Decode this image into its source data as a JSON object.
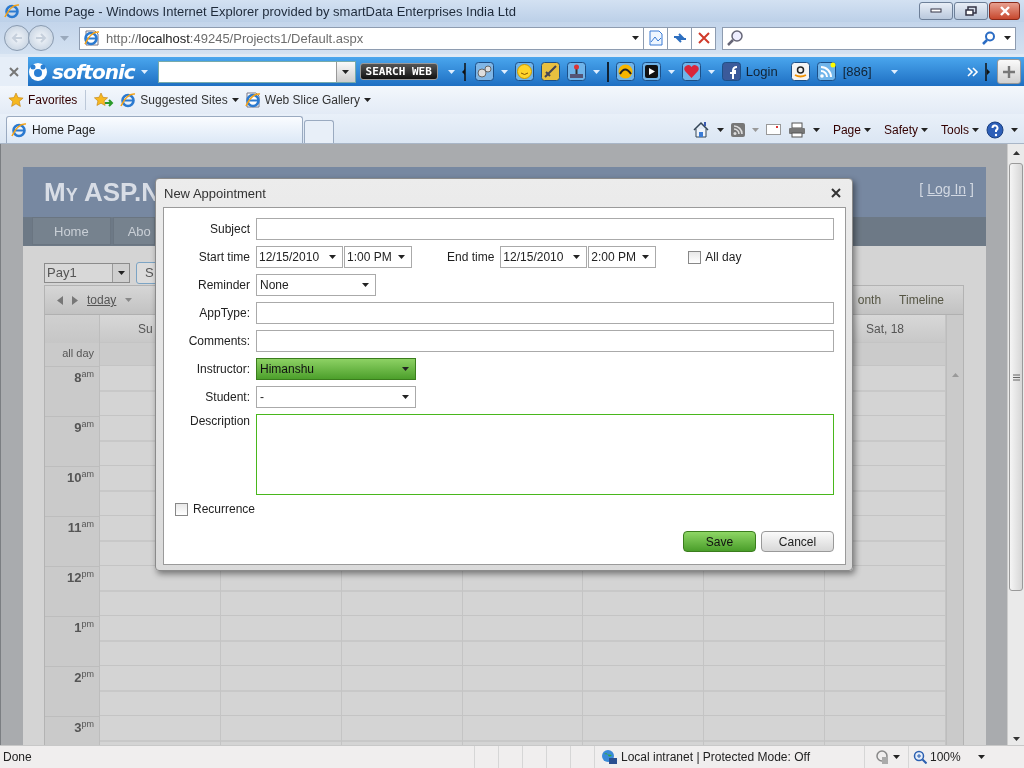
{
  "window": {
    "title": "Home Page - Windows Internet Explorer provided by smartData Enterprises India Ltd"
  },
  "address_bar": {
    "url": "http://**localhost**:49245/Projects1/Default.aspx"
  },
  "softonic_toolbar": {
    "brand": "softonic",
    "search_button": "SEARCH WEB",
    "login": "Login",
    "feed_count": "[886]"
  },
  "favorites_bar": {
    "items": [
      {
        "label": "Favorites",
        "kind": "favorites"
      },
      {
        "label": "Suggested Sites",
        "kind": "link"
      },
      {
        "label": "Web Slice Gallery",
        "kind": "link"
      }
    ]
  },
  "tabs": [
    {
      "label": "Home Page",
      "selected": true
    }
  ],
  "command_bar": {
    "items": [
      {
        "label": "Page"
      },
      {
        "label": "Safety"
      },
      {
        "label": "Tools"
      }
    ]
  },
  "site": {
    "title": "My ASP.N",
    "login": {
      "open": "[",
      "link": "Log In",
      "close": "]"
    },
    "nav": [
      {
        "label": "Home"
      },
      {
        "label": "Abo"
      }
    ]
  },
  "scheduler": {
    "resource": "Pay1",
    "button": "S",
    "today": "today",
    "views": [
      {
        "label": "onth"
      },
      {
        "label": "Timeline"
      }
    ],
    "first_day": "Su",
    "last_day": "Sat, 18",
    "all_day": "all day",
    "hours": [
      "8$^{am}$",
      "9$^{am}$",
      "10$^{am}$",
      "11$^{am}$",
      "12$^{pm}$",
      "1$^{pm}$",
      "2$^{pm}$",
      "3$^{pm}$"
    ]
  },
  "dialog": {
    "title": "New Appointment",
    "subject": {
      "label": "Subject"
    },
    "start": {
      "label": "Start time",
      "date": "12/15/2010",
      "time": "1:00 PM"
    },
    "end": {
      "label": "End time",
      "date": "12/15/2010",
      "time": "2:00 PM"
    },
    "all_day": {
      "label": "All day",
      "checked": false
    },
    "reminder": {
      "label": "Reminder",
      "value": "None"
    },
    "app_type": {
      "label": "AppType:"
    },
    "comments": {
      "label": "Comments:"
    },
    "instructor": {
      "label": "Instructor:",
      "value": "Himanshu",
      "highlighted": true
    },
    "student": {
      "label": "Student:",
      "value": "-",
      "highlighted": false
    },
    "description": {
      "label": "Description",
      "highlighted": true
    },
    "recurrence": {
      "label": "Recurrence",
      "checked": false
    },
    "buttons": [
      {
        "label": "Save",
        "kind": "primary"
      },
      {
        "label": "Cancel",
        "kind": "secondary"
      }
    ]
  },
  "status_bar": {
    "status": "Done",
    "zone": "Local intranet | Protected Mode: Off",
    "zoom": "100%"
  }
}
